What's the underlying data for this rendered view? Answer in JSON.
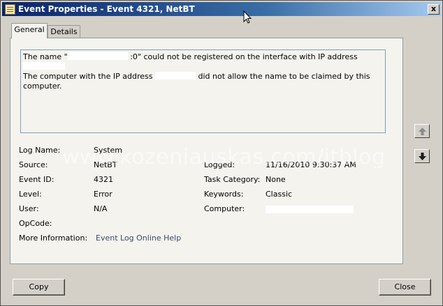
{
  "window": {
    "title": "Event Properties - Event 4321, NetBT",
    "close_glyph": "x"
  },
  "tabs": [
    {
      "label": "General",
      "active": true
    },
    {
      "label": "Details",
      "active": false
    }
  ],
  "description": {
    "part1": "The name \"",
    "part2": " :0\" could not be registered on the interface with IP address ",
    "part3": "The computer with the IP address ",
    "part4": " did not allow the name to be claimed by this computer."
  },
  "fields": {
    "log_name": {
      "label": "Log Name:",
      "value": "System"
    },
    "source": {
      "label": "Source:",
      "value": "NetBT"
    },
    "logged": {
      "label": "Logged:",
      "value": "11/16/2010 9:30:37 AM"
    },
    "event_id": {
      "label": "Event ID:",
      "value": "4321"
    },
    "task_category": {
      "label": "Task Category:",
      "value": "None"
    },
    "level": {
      "label": "Level:",
      "value": "Error"
    },
    "keywords": {
      "label": "Keywords:",
      "value": "Classic"
    },
    "user": {
      "label": "User:",
      "value": "N/A"
    },
    "computer": {
      "label": "Computer:",
      "value": ""
    },
    "opcode": {
      "label": "OpCode:",
      "value": ""
    },
    "more_info": {
      "label": "More Information:",
      "link": "Event Log Online Help"
    }
  },
  "buttons": {
    "copy": "Copy",
    "close": "Close"
  },
  "watermark": "www.kozeniauskas.com/itblog",
  "icons": {
    "nav_up": "arrow-up-icon",
    "nav_down": "arrow-down-icon",
    "title": "event-properties-icon"
  }
}
